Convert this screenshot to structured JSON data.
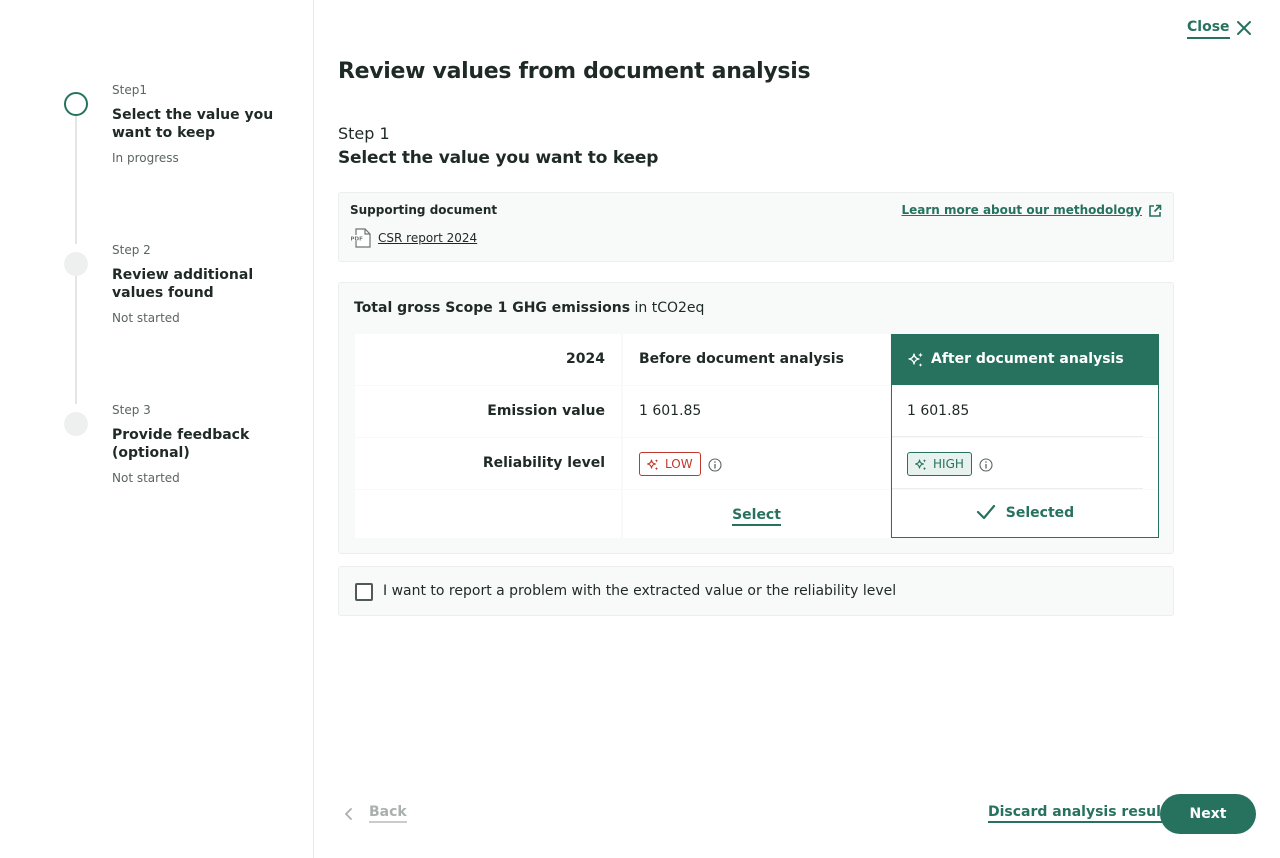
{
  "header": {
    "close_label": "Close",
    "title": "Review values from document analysis"
  },
  "sidebar": {
    "steps": [
      {
        "label": "Step1",
        "title": "Select the value you want to keep",
        "status": "In progress"
      },
      {
        "label": "Step 2",
        "title": "Review additional values found",
        "status": "Not started"
      },
      {
        "label": "Step 3",
        "title": "Provide feedback (optional)",
        "status": "Not started"
      }
    ]
  },
  "main": {
    "step_label": "Step 1",
    "step_title": "Select the value you want to keep",
    "supporting": {
      "label": "Supporting document",
      "document_name": "CSR report 2024",
      "methodology_link": "Learn more about our methodology"
    },
    "table": {
      "metric": "Total gross Scope 1 GHG emissions",
      "unit": "in tCO2eq",
      "year": "2024",
      "before_header": "Before document analysis",
      "after_header": "After document analysis",
      "rows": {
        "emission_label": "Emission value",
        "before_emission": "1 601.85",
        "after_emission": "1 601.85",
        "reliability_label": "Reliability level",
        "before_reliability": "LOW",
        "after_reliability": "HIGH"
      },
      "select_label": "Select",
      "selected_label": "Selected"
    },
    "report_problem_label": "I want to report a problem with the extracted value or the reliability level"
  },
  "footer": {
    "back_label": "Back",
    "discard_label": "Discard analysis result",
    "next_label": "Next"
  },
  "colors": {
    "accent": "#27725f",
    "low": "#c0392b",
    "high_bg": "#e7f2ee"
  }
}
